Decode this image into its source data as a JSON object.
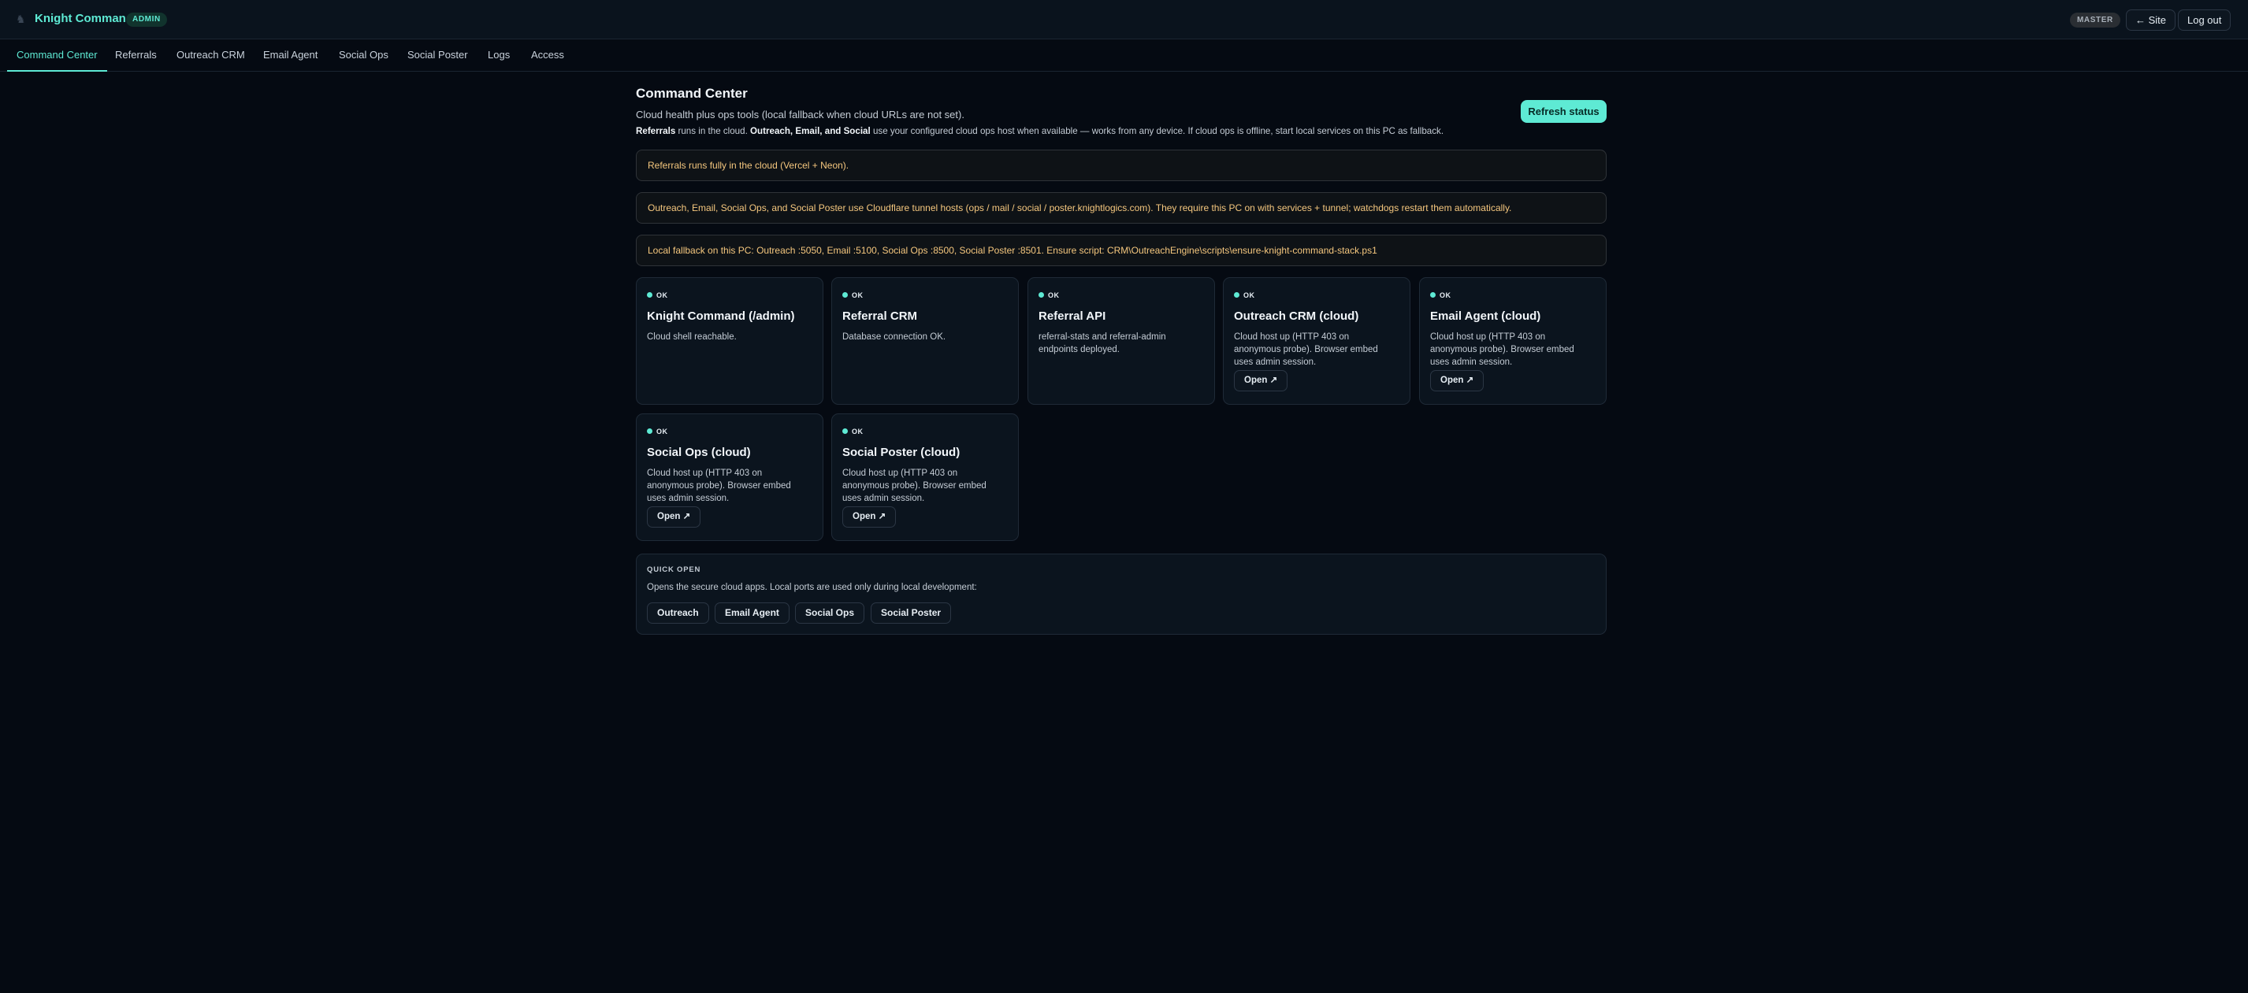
{
  "header": {
    "title": "Knight Command",
    "role_badge": "ADMIN",
    "env_badge": "MASTER",
    "site_link": "← Site",
    "logout": "Log out"
  },
  "nav": {
    "tabs": [
      {
        "label": "Command Center",
        "active": true
      },
      {
        "label": "Referrals"
      },
      {
        "label": "Outreach CRM"
      },
      {
        "label": "Email Agent"
      },
      {
        "label": "Social Ops"
      },
      {
        "label": "Social Poster"
      },
      {
        "label": "Logs"
      },
      {
        "label": "Access"
      }
    ]
  },
  "main": {
    "title": "Command Center",
    "subtitle": "Cloud health plus ops tools (local fallback when cloud URLs are not set).",
    "info": {
      "part1": "Referrals",
      "part2": " runs in the cloud. ",
      "part3": "Outreach, Email, and Social",
      "part4": " use your configured cloud ops host when available — works from any device. If cloud ops is offline, start local services on this PC as fallback."
    },
    "refresh_label": "Refresh status",
    "notices": [
      "Referrals runs fully in the cloud (Vercel + Neon).",
      "Outreach, Email, Social Ops, and Social Poster use Cloudflare tunnel hosts (ops / mail / social / poster.knightlogics.com). They require this PC on with services + tunnel; watchdogs restart them automatically.",
      "Local fallback on this PC: Outreach :5050, Email :5100, Social Ops :8500, Social Poster :8501. Ensure script: CRM\\OutreachEngine\\scripts\\ensure-knight-command-stack.ps1"
    ],
    "cards": [
      {
        "status": "OK",
        "title": "Knight Command (/admin)",
        "desc": "Cloud shell reachable."
      },
      {
        "status": "OK",
        "title": "Referral CRM",
        "desc": "Database connection OK."
      },
      {
        "status": "OK",
        "title": "Referral API",
        "desc": "referral-stats and referral-admin endpoints deployed."
      },
      {
        "status": "OK",
        "title": "Outreach CRM (cloud)",
        "desc": "Cloud host up (HTTP 403 on anonymous probe). Browser embed uses admin session.",
        "open": "Open ↗"
      },
      {
        "status": "OK",
        "title": "Email Agent (cloud)",
        "desc": "Cloud host up (HTTP 403 on anonymous probe). Browser embed uses admin session.",
        "open": "Open ↗"
      },
      {
        "status": "OK",
        "title": "Social Ops (cloud)",
        "desc": "Cloud host up (HTTP 403 on anonymous probe). Browser embed uses admin session.",
        "open": "Open ↗"
      },
      {
        "status": "OK",
        "title": "Social Poster (cloud)",
        "desc": "Cloud host up (HTTP 403 on anonymous probe). Browser embed uses admin session.",
        "open": "Open ↗"
      }
    ],
    "quick_open": {
      "heading": "QUICK OPEN",
      "desc": "Opens the secure cloud apps. Local ports are used only during local development:",
      "buttons": [
        "Outreach",
        "Email Agent",
        "Social Ops",
        "Social Poster"
      ]
    }
  },
  "colors": {
    "accent": "#5eead4",
    "background": "#050a12",
    "notice_text": "#f5c77e"
  }
}
